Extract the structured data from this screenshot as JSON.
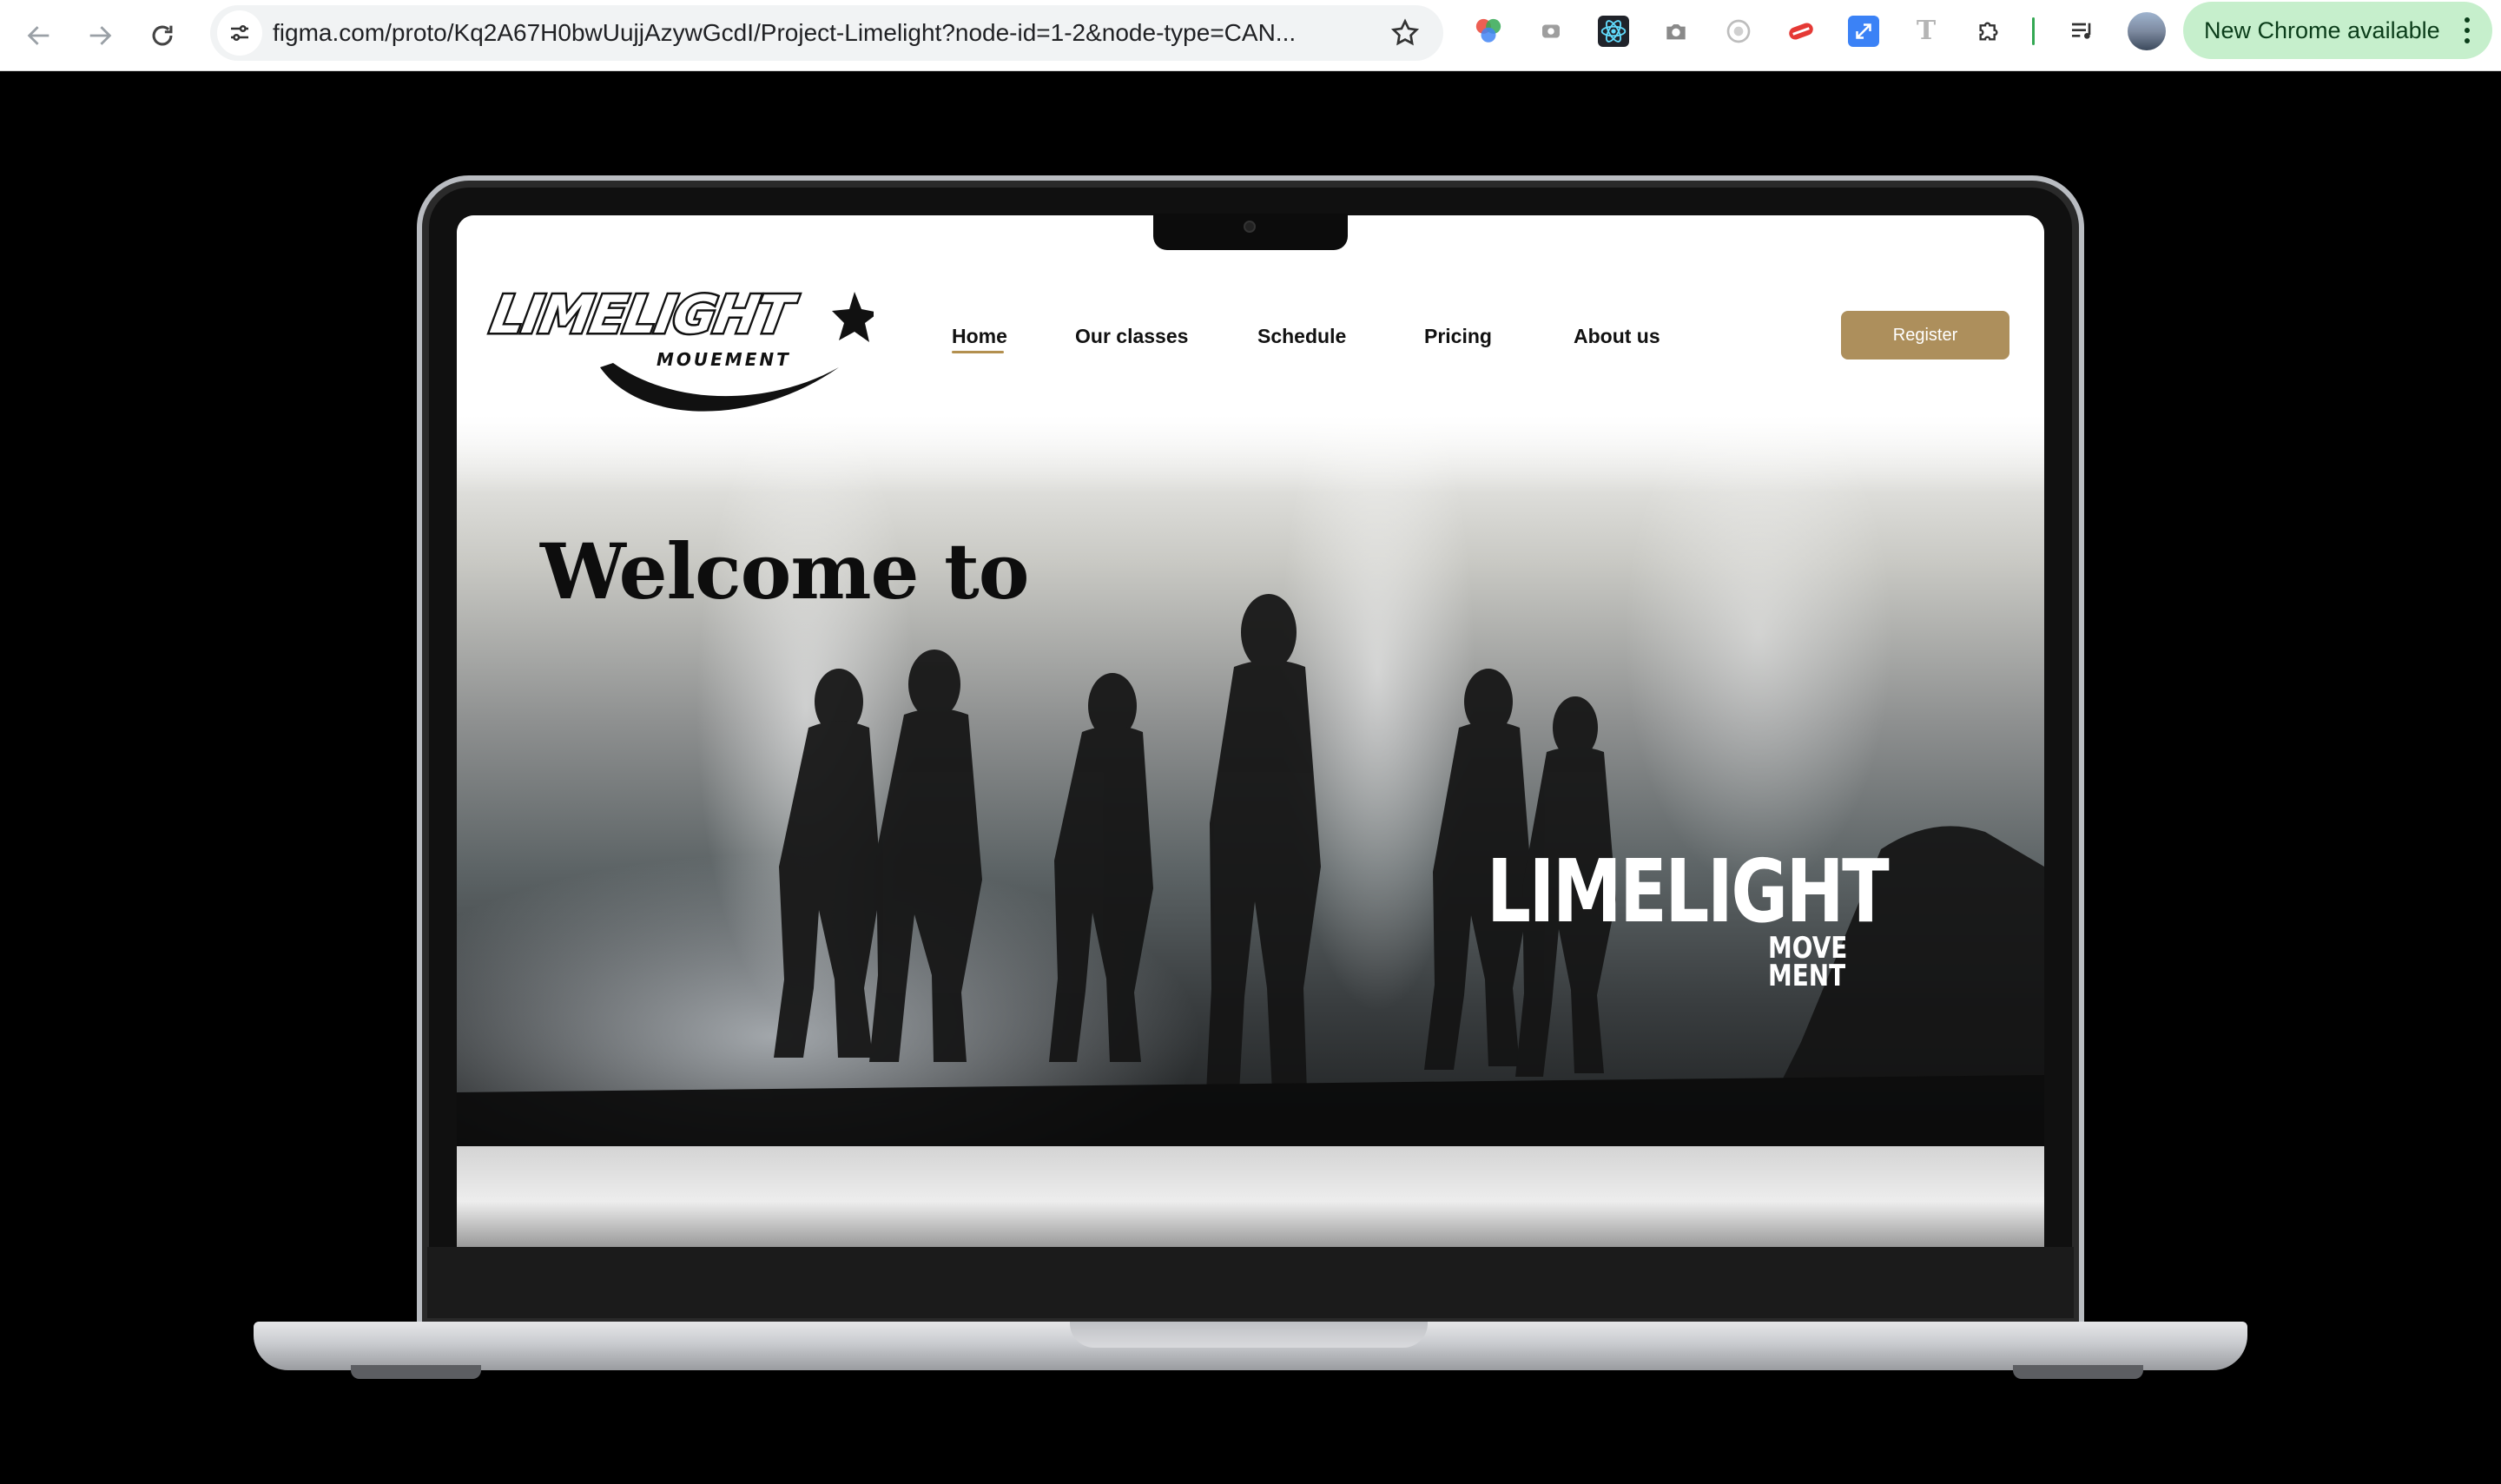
{
  "browser": {
    "url": "figma.com/proto/Kq2A67H0bwUujjAzywGcdI/Project-Limelight?node-id=1-2&node-type=CAN...",
    "update_button_label": "New Chrome available",
    "extensions": [
      "color-picker-icon",
      "screen-record-icon",
      "react-devtools-icon",
      "camera-icon",
      "circle-ext-icon",
      "red-ext-icon",
      "resize-ext-icon",
      "font-ext-icon",
      "puzzle-icon",
      "media-control-icon"
    ]
  },
  "site": {
    "logo": {
      "title": "LIMELIGHT",
      "subtitle": "MOUEMENT"
    },
    "nav": [
      {
        "label": "Home",
        "active": true
      },
      {
        "label": "Our classes"
      },
      {
        "label": "Schedule"
      },
      {
        "label": "Pricing"
      },
      {
        "label": "About us"
      }
    ],
    "register_label": "Register",
    "hero": {
      "heading": "Welcome to",
      "brand_title": "LIMELIGHT",
      "brand_sub_1": "MOVE",
      "brand_sub_2": "MENT"
    }
  },
  "colors": {
    "accent": "#ad8f5c",
    "update_pill": "#c6efcc"
  }
}
